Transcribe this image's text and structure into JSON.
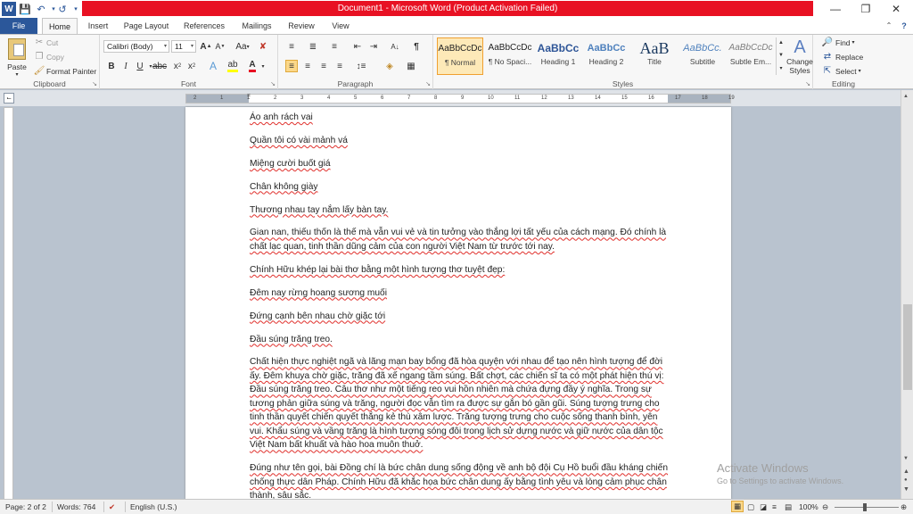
{
  "window": {
    "title": "Document1 - Microsoft Word (Product Activation Failed)",
    "minimize_icon": "minimize-icon",
    "restore_icon": "restore-icon",
    "close_icon": "close-icon"
  },
  "quick_access": {
    "app_icon": "word-icon",
    "save_icon": "save-icon",
    "undo_icon": "undo-icon",
    "redo_icon": "redo-icon"
  },
  "tabs": {
    "file": "File",
    "home": "Home",
    "insert": "Insert",
    "page_layout": "Page Layout",
    "references": "References",
    "mailings": "Mailings",
    "review": "Review",
    "view": "View"
  },
  "ribbon": {
    "clipboard": {
      "label": "Clipboard",
      "paste": "Paste",
      "cut": "Cut",
      "copy": "Copy",
      "format_painter": "Format Painter"
    },
    "font": {
      "label": "Font",
      "font_name": "Calibri (Body)",
      "font_size": "11"
    },
    "paragraph": {
      "label": "Paragraph"
    },
    "styles": {
      "label": "Styles",
      "items": [
        {
          "preview": "AaBbCcDc",
          "name": "¶ Normal"
        },
        {
          "preview": "AaBbCcDc",
          "name": "¶ No Spaci..."
        },
        {
          "preview": "AaBbCc",
          "name": "Heading 1"
        },
        {
          "preview": "AaBbCc",
          "name": "Heading 2"
        },
        {
          "preview": "AaB",
          "name": "Title"
        },
        {
          "preview": "AaBbCc.",
          "name": "Subtitle"
        },
        {
          "preview": "AaBbCcDc",
          "name": "Subtle Em..."
        }
      ],
      "change_styles": "Change Styles"
    },
    "editing": {
      "label": "Editing",
      "find": "Find",
      "replace": "Replace",
      "select": "Select"
    }
  },
  "ruler_numbers": [
    "2",
    "1",
    "1",
    "2",
    "3",
    "4",
    "5",
    "6",
    "7",
    "8",
    "9",
    "10",
    "11",
    "12",
    "13",
    "14",
    "15",
    "16",
    "17",
    "18",
    "19"
  ],
  "document": {
    "paragraphs": [
      "Áo anh rách vai",
      "Quần tôi có vài mảnh vá",
      "Miệng cười buốt giá",
      "Chân không giày",
      "Thương nhau tay nắm lấy bàn tay.",
      "Gian nan, thiếu thốn là thế mà vẫn vui vẻ và tin tưởng vào thắng lợi tất yếu của cách mạng. Đó chính là chất lạc quan, tinh thần dũng cảm của con người Việt Nam từ trước tới nay.",
      "Chính Hữu khép lại bài thơ bằng một hình tượng thơ tuyệt đẹp:",
      "Đêm nay rừng hoang sương muối",
      "Đứng cạnh bên nhau chờ giặc tới",
      "Đầu súng trăng treo.",
      "Chất hiện thực nghiệt ngã và lãng mạn bay bổng đã hòa quyện với nhau để tạo nên hình tượng để đời ấy. Đêm khuya chờ giặc, trăng đã xế ngang tầm súng. Bất chợt, các chiến sĩ ta có một phát hiện thú vị: Đầu súng trăng treo. Câu thơ như một tiếng reo vui hồn nhiên mà chứa đựng đầy ý nghĩa. Trong sự tương phản giữa súng và trăng, người đọc vẫn tìm ra được sự gắn bó gần gũi. Súng tượng trưng cho tinh thần quyết chiến quyết thắng kẻ thù xâm lược. Trăng tượng trưng cho cuộc sống thanh bình, yên vui. Khẩu súng và vầng trăng là hình tượng sóng đôi trong lịch sử dựng nước và giữ nước của dân tộc Việt Nam bất khuất và hào hoa muôn thuở.",
      "Đúng như tên gọi, bài Đồng chí là bức chân dung sống động về anh bộ đội Cụ Hồ buổi đầu kháng chiến chống thực dân Pháp. Chính Hữu đã khắc họa bức chân dung ấy bằng tình yêu và lòng cảm phục chân thành, sâu sắc."
    ]
  },
  "watermark": {
    "line1": "Activate Windows",
    "line2": "Go to Settings to activate Windows."
  },
  "status": {
    "page": "Page: 2 of 2",
    "words": "Words: 764",
    "language": "English (U.S.)",
    "zoom": "100%"
  },
  "colors": {
    "title_strip": "#e81123",
    "file_tab": "#2b579a",
    "spell_underline": "#e0302c"
  }
}
